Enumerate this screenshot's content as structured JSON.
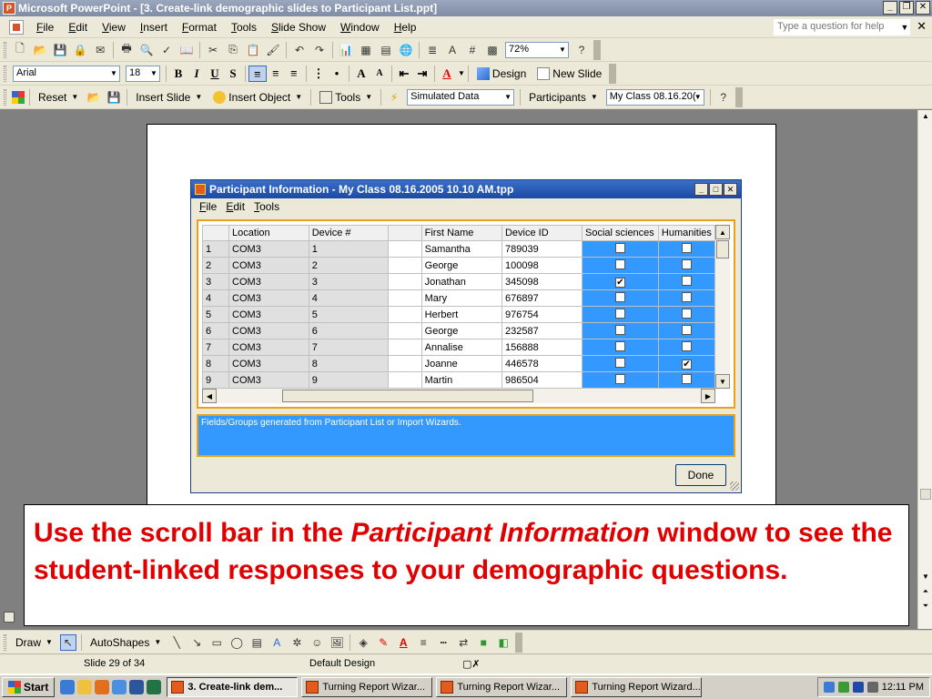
{
  "window": {
    "title": "Microsoft PowerPoint - [3. Create-link demographic slides to Participant List.ppt]",
    "help_placeholder": "Type a question for help"
  },
  "menu": [
    "File",
    "Edit",
    "View",
    "Insert",
    "Format",
    "Tools",
    "Slide Show",
    "Window",
    "Help"
  ],
  "standard_toolbar": {
    "zoom": "72%"
  },
  "formatting_toolbar": {
    "font": "Arial",
    "size": "18",
    "design_label": "Design",
    "new_slide_label": "New Slide"
  },
  "turning_toolbar": {
    "reset": "Reset",
    "insert_slide": "Insert Slide",
    "insert_object": "Insert Object",
    "tools": "Tools",
    "data_mode": "Simulated Data",
    "participants": "Participants",
    "participant_list": "My Class 08.16.20("
  },
  "dialog": {
    "title": "Participant Information - My Class 08.16.2005 10.10 AM.tpp",
    "menu": [
      "File",
      "Edit",
      "Tools"
    ],
    "columns": [
      "",
      "Location",
      "Device #",
      "",
      "First Name",
      "Device ID",
      "Social sciences",
      "Humanities"
    ],
    "rows": [
      {
        "n": "1",
        "loc": "COM3",
        "dev": "1",
        "name": "Samantha",
        "id": "789039",
        "soc": false,
        "hum": false
      },
      {
        "n": "2",
        "loc": "COM3",
        "dev": "2",
        "name": "George",
        "id": "100098",
        "soc": false,
        "hum": false
      },
      {
        "n": "3",
        "loc": "COM3",
        "dev": "3",
        "name": "Jonathan",
        "id": "345098",
        "soc": true,
        "hum": false
      },
      {
        "n": "4",
        "loc": "COM3",
        "dev": "4",
        "name": "Mary",
        "id": "676897",
        "soc": false,
        "hum": false
      },
      {
        "n": "5",
        "loc": "COM3",
        "dev": "5",
        "name": "Herbert",
        "id": "976754",
        "soc": false,
        "hum": false
      },
      {
        "n": "6",
        "loc": "COM3",
        "dev": "6",
        "name": "George",
        "id": "232587",
        "soc": false,
        "hum": false
      },
      {
        "n": "7",
        "loc": "COM3",
        "dev": "7",
        "name": "Annalise",
        "id": "156888",
        "soc": false,
        "hum": false
      },
      {
        "n": "8",
        "loc": "COM3",
        "dev": "8",
        "name": "Joanne",
        "id": "446578",
        "soc": false,
        "hum": true
      },
      {
        "n": "9",
        "loc": "COM3",
        "dev": "9",
        "name": "Martin",
        "id": "986504",
        "soc": false,
        "hum": false
      }
    ],
    "info_text": "Fields/Groups generated from Participant List or Import Wizards.",
    "done_label": "Done"
  },
  "callout": {
    "before": "Use the scroll bar in the ",
    "emphasis": "Participant Information",
    "after": " window to see the student-linked responses to your demographic questions."
  },
  "drawing_toolbar": {
    "draw": "Draw",
    "autoshapes": "AutoShapes"
  },
  "status": {
    "slide": "Slide 29 of 34",
    "design": "Default Design"
  },
  "taskbar": {
    "start": "Start",
    "tasks": [
      "3. Create-link dem...",
      "Turning Report Wizar...",
      "Turning Report Wizar...",
      "Turning Report Wizard..."
    ],
    "clock": "12:11 PM"
  },
  "colors": {
    "callout_text": "#e00000",
    "selection_blue": "#3399ff",
    "frame_orange": "#e7a11a"
  }
}
